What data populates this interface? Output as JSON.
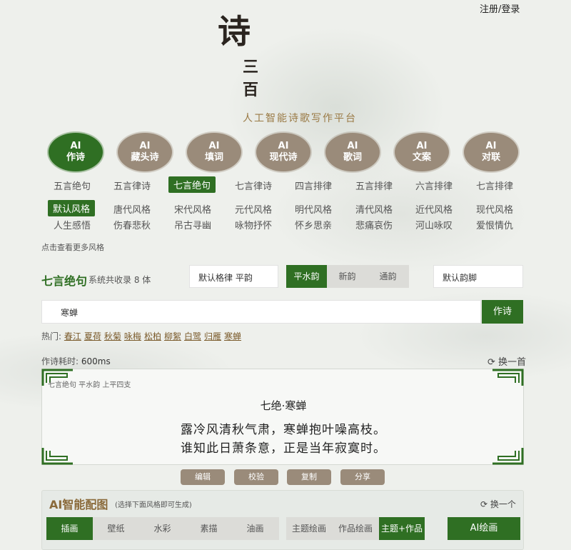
{
  "header": {
    "login": "注册/登录"
  },
  "logo": {
    "char1": "诗",
    "char2": "三",
    "char3": "百",
    "subtitle": "人工智能诗歌写作平台"
  },
  "modes": [
    {
      "line1": "AI",
      "line2": "作诗"
    },
    {
      "line1": "AI",
      "line2": "藏头诗"
    },
    {
      "line1": "AI",
      "line2": "填词"
    },
    {
      "line1": "AI",
      "line2": "现代诗"
    },
    {
      "line1": "AI",
      "line2": "歌词"
    },
    {
      "line1": "AI",
      "line2": "文案"
    },
    {
      "line1": "AI",
      "line2": "对联"
    }
  ],
  "forms": [
    "五言绝句",
    "五言律诗",
    "七言绝句",
    "七言律诗",
    "四言排律",
    "五言排律",
    "六言排律",
    "七言排律"
  ],
  "styles_row1": [
    "默认风格",
    "唐代风格",
    "宋代风格",
    "元代风格",
    "明代风格",
    "清代风格",
    "近代风格",
    "现代风格"
  ],
  "styles_row2": [
    "人生感悟",
    "伤春悲秋",
    "吊古寻幽",
    "咏物抒怀",
    "怀乡思亲",
    "悲痛哀伤",
    "河山咏叹",
    "爱恨情仇"
  ],
  "more_styles": "点击查看更多风格",
  "form_bar": {
    "title": "七言绝句",
    "count": "系统共收录 8 体",
    "meter": "默认格律 平韵",
    "yun": [
      "平水韵",
      "新韵",
      "通韵"
    ],
    "foot": "默认韵脚"
  },
  "theme": {
    "value": "寒蝉",
    "button": "作诗"
  },
  "hot": {
    "label": "热门:",
    "items": [
      "春江",
      "夏荷",
      "秋菊",
      "咏梅",
      "松柏",
      "柳絮",
      "白鹭",
      "归雁",
      "寒蝉"
    ]
  },
  "timing": {
    "label": "作诗耗时:",
    "value": "600ms",
    "swap": "换一首"
  },
  "poem": {
    "meta": "七言绝句 平水韵 上平四支",
    "title": "七绝·寒蝉",
    "lines": [
      "露冷风清秋气肃，寒蝉抱叶噪高枝。",
      "谁知此日萧条意，正是当年寂寞时。"
    ]
  },
  "actions": [
    "编辑",
    "校验",
    "复制",
    "分享"
  ],
  "ai_image": {
    "title": "AI智能配图",
    "sub": "(选择下面风格即可生成)",
    "swap": "换一个",
    "styles": [
      "插画",
      "壁纸",
      "水彩",
      "素描",
      "油画"
    ],
    "modes": [
      "主题绘画",
      "作品绘画",
      "主题+作品"
    ],
    "button": "AI绘画"
  },
  "colors": {
    "accent": "#2f6f23",
    "muted": "#9a8b7a",
    "gold": "#9a7a45"
  }
}
